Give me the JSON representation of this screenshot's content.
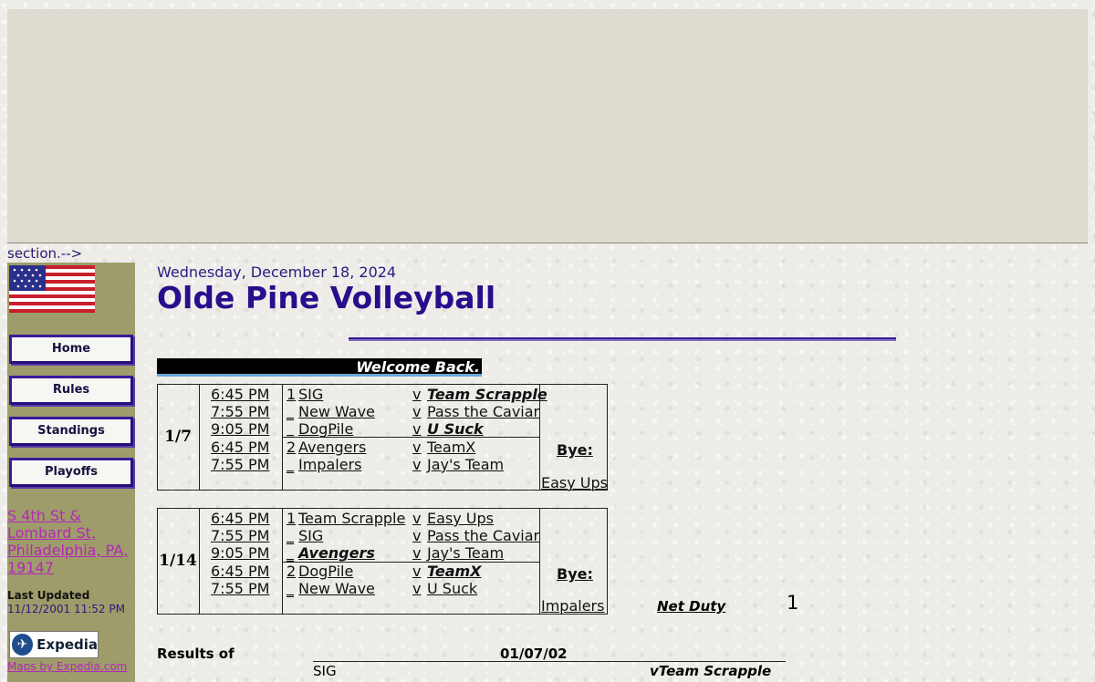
{
  "section_text": "section.-->",
  "sidebar": {
    "nav": [
      "Home",
      "Rules",
      "Standings",
      "Playoffs"
    ],
    "address": "S 4th St & Lombard St, Philadelphia, PA, 19147",
    "last_updated_label": "Last Updated",
    "last_updated_value": "11/12/2001 11:52 PM",
    "expedia_logo": "Expedia",
    "maps_link": "Maps by Expedia.com"
  },
  "date": "Wednesday, December 18, 2024",
  "title": "Olde Pine Volleyball",
  "welcome": "Welcome Back.",
  "weeks": [
    {
      "date": "1/7",
      "bye_label": "Bye:",
      "bye_team": "Easy Ups",
      "games": [
        {
          "time": "6:45 PM",
          "court": "1",
          "team_a": "SIG",
          "v": "v",
          "team_b": "Team Scrapple"
        },
        {
          "time": "7:55 PM",
          "court": "_",
          "team_a": "New Wave",
          "v": "v",
          "team_b": "Pass the Caviar"
        },
        {
          "time": "9:05 PM",
          "court": "_",
          "team_a": "DogPile",
          "v": "v",
          "team_b": "U Suck"
        },
        {
          "time": "6:45 PM",
          "court": "2",
          "team_a": "Avengers",
          "v": "v",
          "team_b": "TeamX"
        },
        {
          "time": "7:55 PM",
          "court": "_",
          "team_a": "Impalers",
          "v": "v",
          "team_b": "Jay's Team"
        }
      ]
    },
    {
      "date": "1/14",
      "bye_label": "Bye:",
      "bye_team": "Impalers",
      "games": [
        {
          "time": "6:45 PM",
          "court": "1",
          "team_a": "Team Scrapple",
          "v": "v",
          "team_b": "Easy Ups"
        },
        {
          "time": "7:55 PM",
          "court": "_",
          "team_a": "SIG",
          "v": "v",
          "team_b": "Pass the Caviar"
        },
        {
          "time": "9:05 PM",
          "court": "_",
          "team_a": "Avengers",
          "v": "v",
          "team_b": "Jay's Team"
        },
        {
          "time": "6:45 PM",
          "court": "2",
          "team_a": "DogPile",
          "v": "v",
          "team_b": "TeamX"
        },
        {
          "time": "7:55 PM",
          "court": "_",
          "team_a": "New Wave",
          "v": "v",
          "team_b": "U Suck"
        }
      ]
    }
  ],
  "net_duty": {
    "label": "Net Duty",
    "value": "1"
  },
  "results": {
    "label": "Results of",
    "date": "01/07/02",
    "team_a": "SIG",
    "team_b": "vTeam Scrapple"
  }
}
